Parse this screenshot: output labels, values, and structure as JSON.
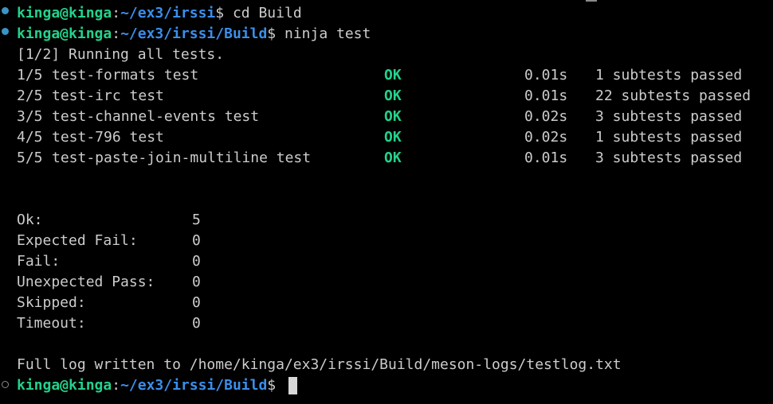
{
  "colors": {
    "background": "#000000",
    "text": "#cccccc",
    "user": "#23d18b",
    "path": "#3b8eea",
    "ok": "#23d18b",
    "dot_success": "#3a94c5"
  },
  "prompts": [
    {
      "user": "kinga@kinga",
      "sep": ":",
      "path": "~/ex3/irssi",
      "symbol": "$",
      "command": " cd Build"
    },
    {
      "user": "kinga@kinga",
      "sep": ":",
      "path": "~/ex3/irssi/Build",
      "symbol": "$",
      "command": " ninja test"
    },
    {
      "user": "kinga@kinga",
      "sep": ":",
      "path": "~/ex3/irssi/Build",
      "symbol": "$",
      "command": " "
    }
  ],
  "running_line": "[1/2] Running all tests.",
  "tests": [
    {
      "index": "1/5",
      "name": "test-formats test",
      "status": "OK",
      "time": "0.01s",
      "subtests": "1 subtests passed"
    },
    {
      "index": "2/5",
      "name": "test-irc test",
      "status": "OK",
      "time": "0.01s",
      "subtests": "22 subtests passed"
    },
    {
      "index": "3/5",
      "name": "test-channel-events test",
      "status": "OK",
      "time": "0.02s",
      "subtests": "3 subtests passed"
    },
    {
      "index": "4/5",
      "name": "test-796 test",
      "status": "OK",
      "time": "0.02s",
      "subtests": "1 subtests passed"
    },
    {
      "index": "5/5",
      "name": "test-paste-join-multiline test",
      "status": "OK",
      "time": "0.01s",
      "subtests": "3 subtests passed"
    }
  ],
  "summary": [
    {
      "label": "Ok:",
      "value": "5"
    },
    {
      "label": "Expected Fail:",
      "value": "0"
    },
    {
      "label": "Fail:",
      "value": "0"
    },
    {
      "label": "Unexpected Pass:",
      "value": "0"
    },
    {
      "label": "Skipped:",
      "value": "0"
    },
    {
      "label": "Timeout:",
      "value": "0"
    }
  ],
  "log_line": "Full log written to /home/kinga/ex3/irssi/Build/meson-logs/testlog.txt"
}
